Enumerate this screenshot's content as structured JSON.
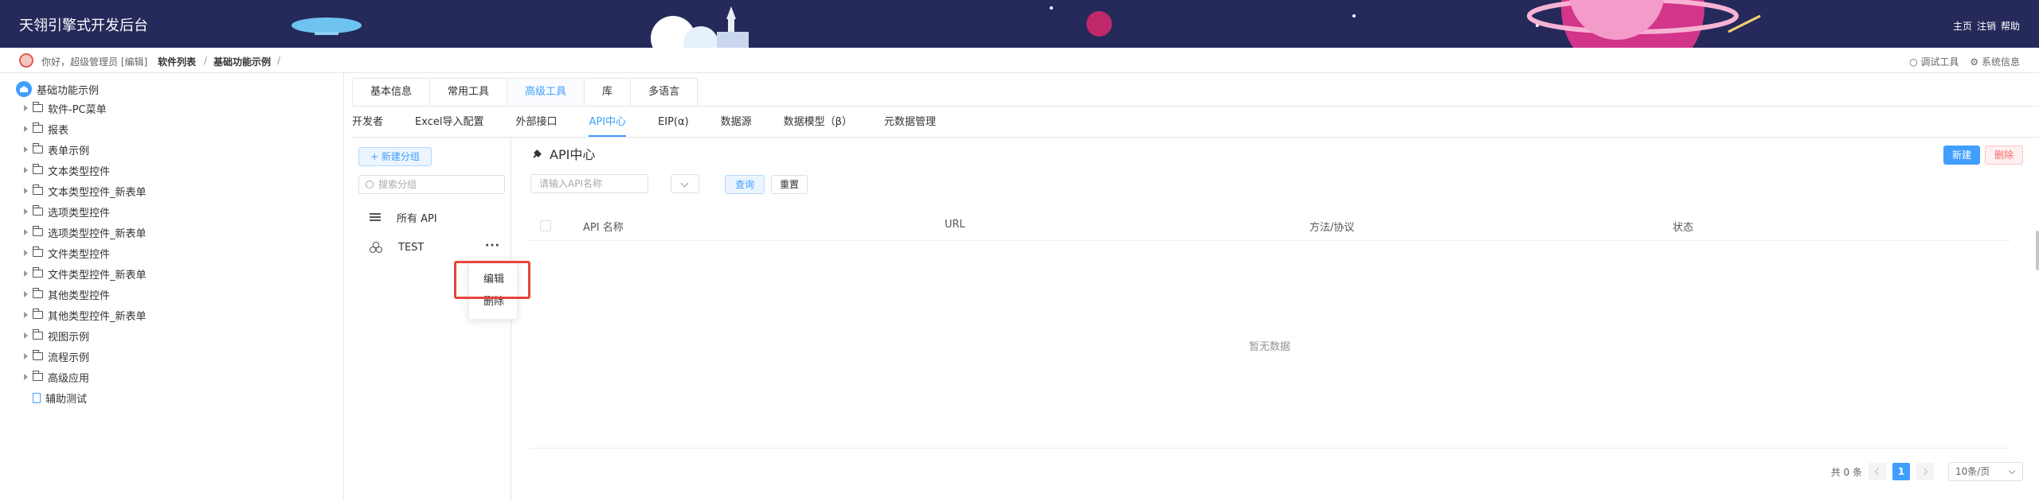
{
  "header": {
    "title": "天翎引擎式开发后台",
    "links": [
      "主页",
      "注销",
      "帮助"
    ]
  },
  "breadcrumb": {
    "greeting": "你好，超级管理员 [编辑]",
    "items": [
      "软件列表",
      "基础功能示例"
    ],
    "separator": "/",
    "tools": [
      "调试工具",
      "系统信息"
    ]
  },
  "tree": {
    "root": "基础功能示例",
    "items": [
      "软件-PC菜单",
      "报表",
      "表单示例",
      "文本类型控件",
      "文本类型控件_新表单",
      "选项类型控件",
      "选项类型控件_新表单",
      "文件类型控件",
      "文件类型控件_新表单",
      "其他类型控件",
      "其他类型控件_新表单",
      "视图示例",
      "流程示例",
      "高级应用"
    ],
    "file_item": "辅助测试"
  },
  "tabs_primary": [
    "基本信息",
    "常用工具",
    "高级工具",
    "库",
    "多语言"
  ],
  "tabs_primary_active": 2,
  "tabs_secondary": [
    "开发者",
    "Excel导入配置",
    "外部接口",
    "API中心",
    "EIP(α)",
    "数据源",
    "数据模型（β）",
    "元数据管理"
  ],
  "tabs_secondary_active": 3,
  "groups": {
    "new_button": "+ 新建分组",
    "search_placeholder": "搜索分组",
    "all_label": "所有 API",
    "group_name": "TEST",
    "more": "···",
    "menu_edit": "编辑",
    "menu_delete": "删除"
  },
  "api": {
    "title": "API中心",
    "new_button": "新建",
    "delete_button": "删除",
    "search_placeholder": "请输入API名称",
    "query_button": "查询",
    "reset_button": "重置",
    "columns": [
      "API 名称",
      "URL",
      "方法/协议",
      "状态"
    ],
    "empty": "暂无数据"
  },
  "pager": {
    "total": "共 0 条",
    "page": "1",
    "page_size": "10条/页"
  },
  "colors": {
    "header_bg": "#252a5a",
    "accent": "#409eff",
    "danger": "#f56c6c",
    "highlight": "#e5453b"
  }
}
